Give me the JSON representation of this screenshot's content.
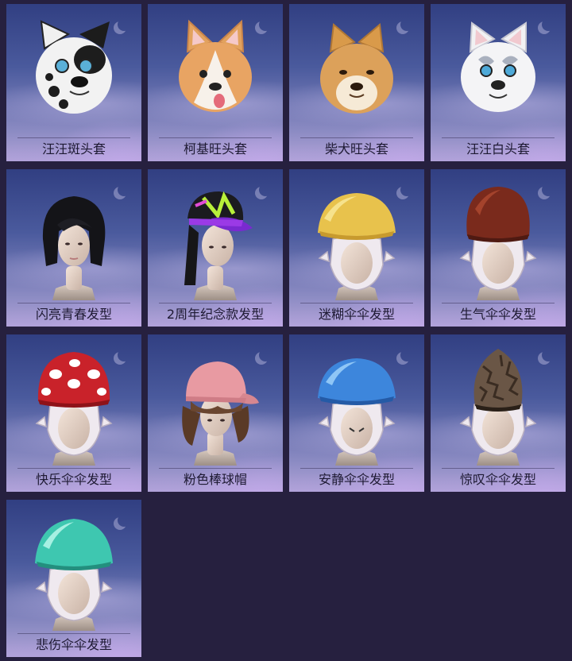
{
  "items": [
    {
      "label": "汪汪斑头套",
      "icon": "dalmatian-dog-head-icon"
    },
    {
      "label": "柯基旺头套",
      "icon": "corgi-dog-head-icon"
    },
    {
      "label": "柴犬旺头套",
      "icon": "shiba-dog-head-icon"
    },
    {
      "label": "汪汪白头套",
      "icon": "white-husky-dog-head-icon"
    },
    {
      "label": "闪亮青春发型",
      "icon": "black-bob-hairstyle-icon"
    },
    {
      "label": "2周年纪念款发型",
      "icon": "anniversary-cap-hairstyle-icon"
    },
    {
      "label": "迷糊伞伞发型",
      "icon": "yellow-mushroom-hat-icon"
    },
    {
      "label": "生气伞伞发型",
      "icon": "brown-mushroom-hat-icon"
    },
    {
      "label": "快乐伞伞发型",
      "icon": "red-spotted-mushroom-hat-icon"
    },
    {
      "label": "粉色棒球帽",
      "icon": "pink-baseball-cap-icon"
    },
    {
      "label": "安静伞伞发型",
      "icon": "blue-mushroom-hat-icon"
    },
    {
      "label": "惊叹伞伞发型",
      "icon": "morel-mushroom-hat-icon"
    },
    {
      "label": "悲伤伞伞发型",
      "icon": "teal-mushroom-hat-icon"
    }
  ]
}
